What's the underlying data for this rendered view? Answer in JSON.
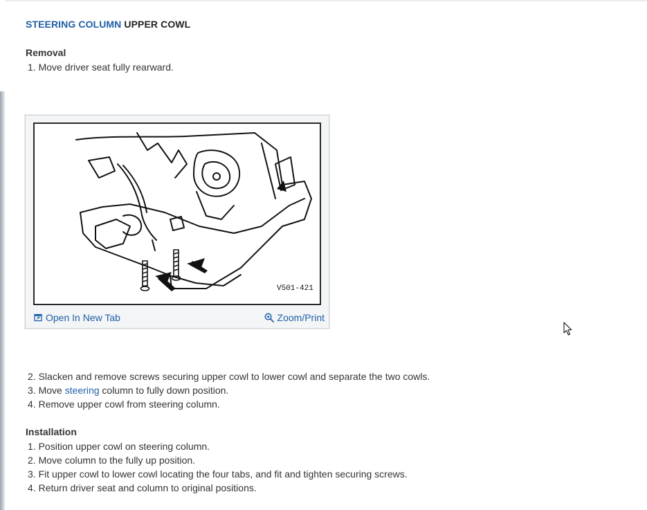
{
  "title": {
    "link": "STEERING COLUMN",
    "rest": " UPPER COWL"
  },
  "removal": {
    "heading": "Removal",
    "steps": [
      {
        "num": "1.",
        "text": "Move driver seat fully rearward."
      },
      {
        "num": "2.",
        "text": "Slacken and remove screws securing upper cowl to lower cowl and separate the two cowls."
      },
      {
        "num": "3.",
        "pre": "Move ",
        "link": "steering",
        "post": " column to fully down position."
      },
      {
        "num": "4.",
        "text": "Remove upper cowl from steering column."
      }
    ]
  },
  "figure": {
    "code": "V501-421",
    "open_label": "Open In New Tab",
    "zoom_label": "Zoom/Print",
    "open_icon": "open-new-tab-icon",
    "zoom_icon": "zoom-in-icon"
  },
  "installation": {
    "heading": "Installation",
    "steps": [
      {
        "num": "1.",
        "text": "Position upper cowl on steering column."
      },
      {
        "num": "2.",
        "text": "Move column to the fully up position."
      },
      {
        "num": "3.",
        "text": "Fit upper cowl to lower cowl locating the four tabs, and fit and tighten securing screws."
      },
      {
        "num": "4.",
        "text": "Return driver seat and column to original positions."
      }
    ]
  }
}
